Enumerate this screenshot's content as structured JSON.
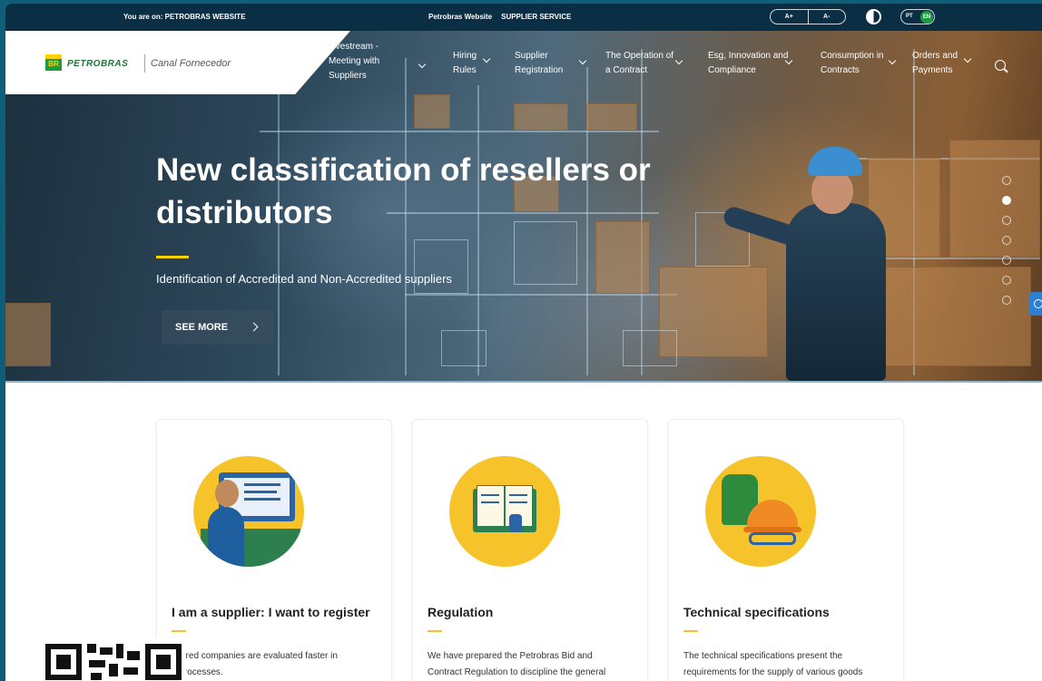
{
  "topbar": {
    "crumb": "You are on: PETROBRAS WEBSITE",
    "links": [
      "Petrobras Website",
      "SUPPLIER SERVICE"
    ],
    "font_increase": "A+",
    "font_decrease": "A-",
    "lang_pt": "PT",
    "lang_en": "EN"
  },
  "logo": {
    "mark": "BR",
    "brand": "PETROBRAS",
    "channel": "Canal Fornecedor"
  },
  "nav": {
    "items": [
      {
        "label": "Livestream - Meeting with Suppliers"
      },
      {
        "label": "Hiring Rules"
      },
      {
        "label": "Supplier Registration"
      },
      {
        "label": "The Operation of a Contract"
      },
      {
        "label": "Esg, Innovation and Compliance"
      },
      {
        "label": "Consumption in Contracts"
      },
      {
        "label": "Orders and Payments"
      }
    ]
  },
  "hero": {
    "title": "New classification of resellers or distributors",
    "subtitle": "Identification of Accredited and Non-Accredited suppliers",
    "cta": "SEE MORE",
    "slide_count": 7,
    "active_slide": 2
  },
  "cards": [
    {
      "title": "I am a supplier: I want to register",
      "text_1": "istered companies are evaluated faster in",
      "text_2": "g processes."
    },
    {
      "title": "Regulation",
      "text_1": "We have prepared the Petrobras Bid and",
      "text_2": "Contract Regulation to discipline the general"
    },
    {
      "title": "Technical specifications",
      "text_1": "The technical specifications present the",
      "text_2": "requirements for the supply of various goods"
    }
  ],
  "colors": {
    "brand_green": "#1e9b3f",
    "brand_yellow": "#ffd200",
    "topbar": "#0a2f44",
    "accent": "#f6c32a"
  }
}
